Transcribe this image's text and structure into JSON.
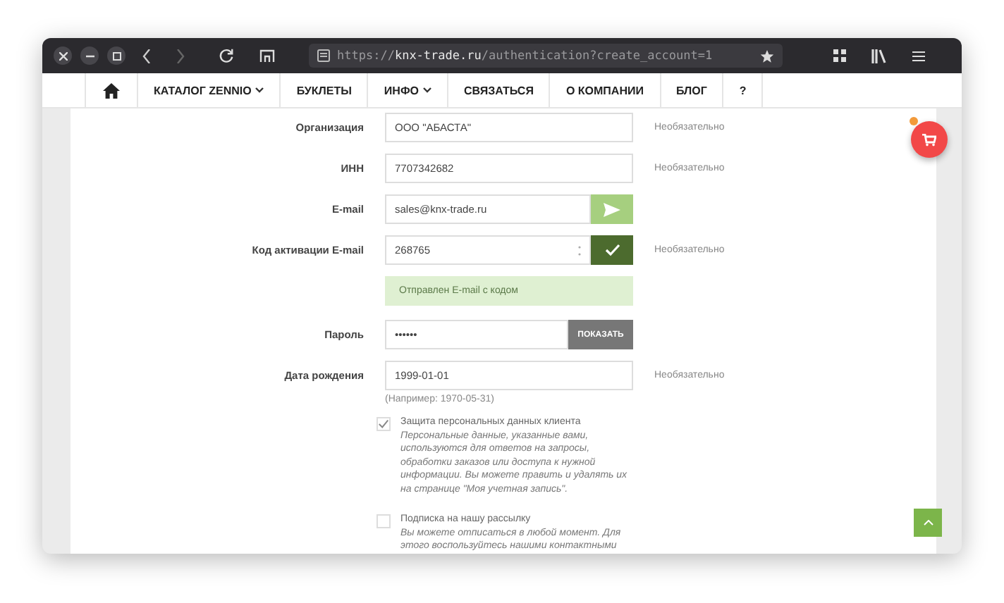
{
  "browser": {
    "url": {
      "scheme": "https://",
      "host": "knx-trade.ru",
      "path": "/authentication?create_account=1"
    }
  },
  "nav": {
    "items": [
      {
        "label": "КАТАЛОГ ZENNIO",
        "dropdown": true
      },
      {
        "label": "БУКЛЕТЫ",
        "dropdown": false
      },
      {
        "label": "ИНФО",
        "dropdown": true
      },
      {
        "label": "СВЯЗАТЬСЯ",
        "dropdown": false
      },
      {
        "label": "О КОМПАНИИ",
        "dropdown": false
      },
      {
        "label": "БЛОГ",
        "dropdown": false
      },
      {
        "label": "?",
        "dropdown": false
      }
    ]
  },
  "form": {
    "rows": [
      {
        "kind": "text",
        "label": "Организация",
        "value": "ООО \"АБАСТА\"",
        "note": "Необязательно"
      },
      {
        "kind": "text",
        "label": "ИНН",
        "value": "7707342682",
        "note": "Необязательно"
      },
      {
        "kind": "email-send",
        "label": "E-mail",
        "value": "sales@knx-trade.ru"
      },
      {
        "kind": "code-confirm",
        "label": "Код активации E-mail",
        "value": "268765",
        "note": "Необязательно"
      },
      {
        "kind": "notice",
        "text": "Отправлен E-mail с кодом"
      },
      {
        "kind": "password",
        "label": "Пароль",
        "value": "••••••",
        "button": "ПОКАЗАТЬ"
      },
      {
        "kind": "text",
        "label": "Дата рождения",
        "value": "1999-01-01",
        "note": "Необязательно",
        "hint": "(Например: 1970-05-31)"
      }
    ],
    "checkboxes": [
      {
        "checked": true,
        "title": "Защита персональных данных клиента",
        "text": "Персональные данные, указанные вами, используются для ответов на запросы, обработки заказов или доступа к нужной информации. Вы можете править и удалять их на странице \"Моя учетная запись\"."
      },
      {
        "checked": false,
        "title": "Подписка на нашу рассылку",
        "text": "Вы можете отписаться в любой момент. Для этого воспользуйтесь нашими контактными"
      }
    ]
  }
}
